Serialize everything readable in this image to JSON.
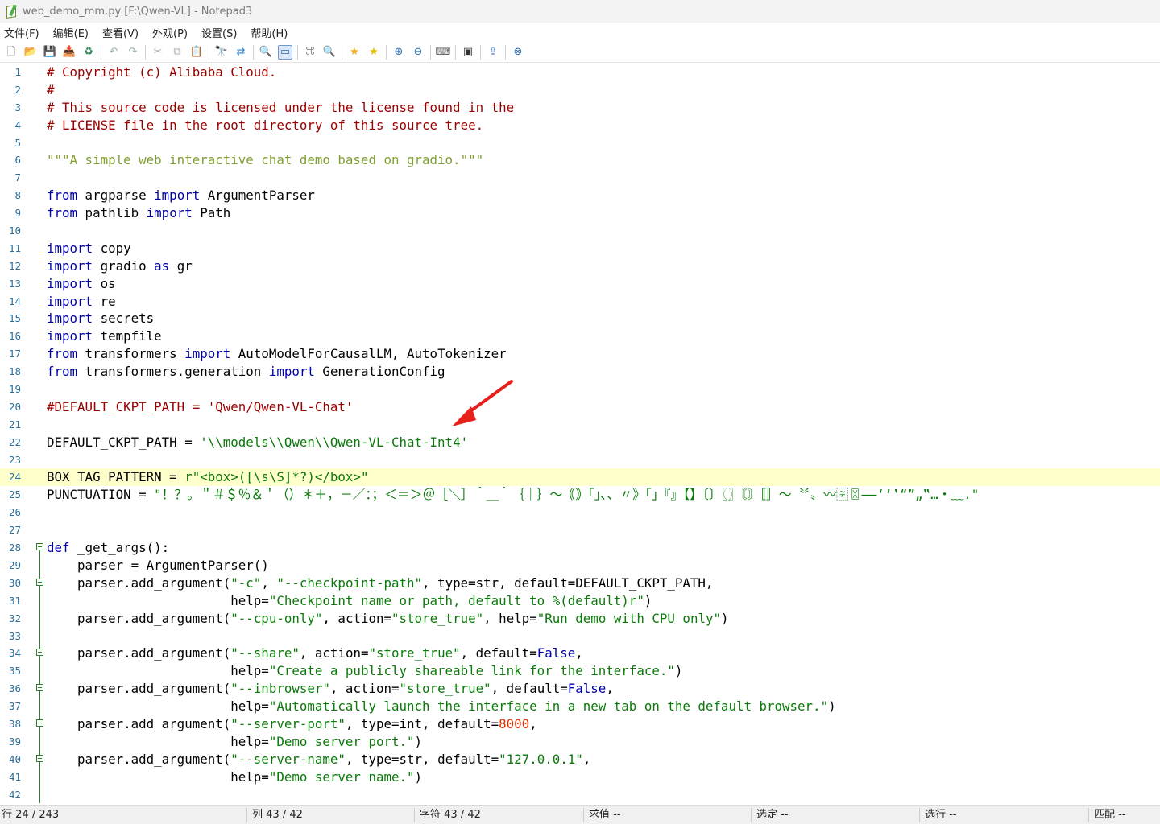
{
  "window": {
    "title": "web_demo_mm.py [F:\\Qwen-VL] - Notepad3"
  },
  "menu": [
    "文件(F)",
    "编辑(E)",
    "查看(V)",
    "外观(P)",
    "设置(S)",
    "帮助(H)"
  ],
  "toolbar": [
    {
      "name": "new-file-icon",
      "glyph": "🗋",
      "color": "#666"
    },
    {
      "name": "open-folder-icon",
      "glyph": "📂",
      "color": "#d4a017"
    },
    {
      "name": "save-icon",
      "glyph": "💾",
      "color": "#777"
    },
    {
      "name": "save-as-icon",
      "glyph": "📥",
      "color": "#c58b00"
    },
    {
      "name": "reload-icon",
      "glyph": "♻",
      "color": "#2e8b57"
    },
    {
      "sep": true
    },
    {
      "name": "undo-icon",
      "glyph": "↶",
      "color": "#9aa"
    },
    {
      "name": "redo-icon",
      "glyph": "↷",
      "color": "#9aa"
    },
    {
      "sep": true
    },
    {
      "name": "cut-icon",
      "glyph": "✂",
      "color": "#aaa"
    },
    {
      "name": "copy-icon",
      "glyph": "⧉",
      "color": "#aaa"
    },
    {
      "name": "paste-icon",
      "glyph": "📋",
      "color": "#777"
    },
    {
      "sep": true
    },
    {
      "name": "find-icon",
      "glyph": "🔭",
      "color": "#444"
    },
    {
      "name": "replace-icon",
      "glyph": "⇄",
      "color": "#2a7fd4"
    },
    {
      "sep": true
    },
    {
      "name": "find-in-files-icon",
      "glyph": "🔍",
      "color": "#555"
    },
    {
      "name": "word-wrap-icon",
      "glyph": "▭",
      "color": "#2a6fb0",
      "active": true
    },
    {
      "sep": true
    },
    {
      "name": "tree-icon",
      "glyph": "⌘",
      "color": "#888"
    },
    {
      "name": "search-icon",
      "glyph": "🔍",
      "color": "#2a6fb0"
    },
    {
      "sep": true
    },
    {
      "name": "favorite-icon",
      "glyph": "★",
      "color": "#f2b01e"
    },
    {
      "name": "add-favorite-icon",
      "glyph": "★",
      "color": "#e0c000"
    },
    {
      "sep": true
    },
    {
      "name": "zoom-in-icon",
      "glyph": "⊕",
      "color": "#2a6fb0"
    },
    {
      "name": "zoom-out-icon",
      "glyph": "⊖",
      "color": "#2a6fb0"
    },
    {
      "sep": true
    },
    {
      "name": "keyboard-icon",
      "glyph": "⌨",
      "color": "#555"
    },
    {
      "sep": true
    },
    {
      "name": "terminal-icon",
      "glyph": "▣",
      "color": "#333"
    },
    {
      "sep": true
    },
    {
      "name": "share-icon",
      "glyph": "⇪",
      "color": "#3a7bd5"
    },
    {
      "sep": true
    },
    {
      "name": "close-icon",
      "glyph": "⊗",
      "color": "#2a6fb0"
    }
  ],
  "colors": {
    "comment": "#9a0000",
    "docstring": "#7fa030",
    "keyword": "#0000a8",
    "string": "#0a7a0a",
    "number": "#e03000",
    "line_number": "#2b6f9a",
    "current_line": "#ffffcc",
    "arrow": "#e8201c"
  },
  "current_line": 24,
  "lines": [
    {
      "n": "1",
      "tokens": [
        [
          "comment",
          "# Copyright (c) Alibaba Cloud."
        ]
      ]
    },
    {
      "n": "2",
      "tokens": [
        [
          "comment",
          "#"
        ]
      ]
    },
    {
      "n": "3",
      "tokens": [
        [
          "comment",
          "# This source code is licensed under the license found in the"
        ]
      ]
    },
    {
      "n": "4",
      "tokens": [
        [
          "comment",
          "# LICENSE file in the root directory of this source tree."
        ]
      ]
    },
    {
      "n": "5",
      "tokens": []
    },
    {
      "n": "6",
      "tokens": [
        [
          "docstring",
          "\"\"\"A simple web interactive chat demo based on gradio.\"\"\""
        ]
      ]
    },
    {
      "n": "7",
      "tokens": []
    },
    {
      "n": "8",
      "tokens": [
        [
          "keyword",
          "from"
        ],
        [
          "text",
          " argparse "
        ],
        [
          "keyword",
          "import"
        ],
        [
          "text",
          " ArgumentParser"
        ]
      ]
    },
    {
      "n": "9",
      "tokens": [
        [
          "keyword",
          "from"
        ],
        [
          "text",
          " pathlib "
        ],
        [
          "keyword",
          "import"
        ],
        [
          "text",
          " Path"
        ]
      ]
    },
    {
      "n": "10",
      "tokens": []
    },
    {
      "n": "11",
      "tokens": [
        [
          "keyword",
          "import"
        ],
        [
          "text",
          " copy"
        ]
      ]
    },
    {
      "n": "12",
      "tokens": [
        [
          "keyword",
          "import"
        ],
        [
          "text",
          " gradio "
        ],
        [
          "keyword",
          "as"
        ],
        [
          "text",
          " gr"
        ]
      ]
    },
    {
      "n": "13",
      "tokens": [
        [
          "keyword",
          "import"
        ],
        [
          "text",
          " os"
        ]
      ]
    },
    {
      "n": "14",
      "tokens": [
        [
          "keyword",
          "import"
        ],
        [
          "text",
          " re"
        ]
      ]
    },
    {
      "n": "15",
      "tokens": [
        [
          "keyword",
          "import"
        ],
        [
          "text",
          " secrets"
        ]
      ]
    },
    {
      "n": "16",
      "tokens": [
        [
          "keyword",
          "import"
        ],
        [
          "text",
          " tempfile"
        ]
      ]
    },
    {
      "n": "17",
      "tokens": [
        [
          "keyword",
          "from"
        ],
        [
          "text",
          " transformers "
        ],
        [
          "keyword",
          "import"
        ],
        [
          "text",
          " AutoModelForCausalLM, AutoTokenizer"
        ]
      ]
    },
    {
      "n": "18",
      "tokens": [
        [
          "keyword",
          "from"
        ],
        [
          "text",
          " transformers.generation "
        ],
        [
          "keyword",
          "import"
        ],
        [
          "text",
          " GenerationConfig"
        ]
      ]
    },
    {
      "n": "19",
      "tokens": []
    },
    {
      "n": "20",
      "tokens": [
        [
          "comment",
          "#DEFAULT_CKPT_PATH = 'Qwen/Qwen-VL-Chat'"
        ]
      ]
    },
    {
      "n": "21",
      "tokens": []
    },
    {
      "n": "22",
      "tokens": [
        [
          "text",
          "DEFAULT_CKPT_PATH = "
        ],
        [
          "string",
          "'\\\\models\\\\Qwen\\\\Qwen-VL-Chat-Int4'"
        ]
      ]
    },
    {
      "n": "23",
      "tokens": []
    },
    {
      "n": "24",
      "tokens": [
        [
          "text",
          "BOX_TAG_PATTERN = "
        ],
        [
          "string",
          "r\"<box>([\\s\\S]*?)</box>\""
        ]
      ]
    },
    {
      "n": "25",
      "tokens": [
        [
          "text",
          "PUNCTUATION = "
        ],
        [
          "string",
          "\"！？。＂＃＄％＆＇（）＊＋，－／：；＜＝＞＠［＼］＾＿｀｛｜｝～｟｠｢｣､、〃》「」『』【】〔〕〖〗〘〙〚〛〜〝〞〟〰〾〿–—‘’‛“”„‟…‧﹏.\""
        ]
      ]
    },
    {
      "n": "26",
      "tokens": []
    },
    {
      "n": "27",
      "tokens": []
    },
    {
      "n": "28",
      "fold": "start",
      "tokens": [
        [
          "keyword",
          "def"
        ],
        [
          "text",
          " _get_args():"
        ]
      ]
    },
    {
      "n": "29",
      "fold": "line",
      "tokens": [
        [
          "text",
          "    parser = ArgumentParser()"
        ]
      ]
    },
    {
      "n": "30",
      "fold": "start",
      "tokens": [
        [
          "text",
          "    parser.add_argument("
        ],
        [
          "string",
          "\"-c\""
        ],
        [
          "text",
          ", "
        ],
        [
          "string",
          "\"--checkpoint-path\""
        ],
        [
          "text",
          ", type=str, default=DEFAULT_CKPT_PATH,"
        ]
      ]
    },
    {
      "n": "31",
      "fold": "end",
      "tokens": [
        [
          "text",
          "                        help="
        ],
        [
          "string",
          "\"Checkpoint name or path, default to %(default)r\""
        ],
        [
          "text",
          ")"
        ]
      ]
    },
    {
      "n": "32",
      "fold": "line",
      "tokens": [
        [
          "text",
          "    parser.add_argument("
        ],
        [
          "string",
          "\"--cpu-only\""
        ],
        [
          "text",
          ", action="
        ],
        [
          "string",
          "\"store_true\""
        ],
        [
          "text",
          ", help="
        ],
        [
          "string",
          "\"Run demo with CPU only\""
        ],
        [
          "text",
          ")"
        ]
      ]
    },
    {
      "n": "33",
      "fold": "line",
      "tokens": []
    },
    {
      "n": "34",
      "fold": "start",
      "tokens": [
        [
          "text",
          "    parser.add_argument("
        ],
        [
          "string",
          "\"--share\""
        ],
        [
          "text",
          ", action="
        ],
        [
          "string",
          "\"store_true\""
        ],
        [
          "text",
          ", default="
        ],
        [
          "keyword",
          "False"
        ],
        [
          "text",
          ","
        ]
      ]
    },
    {
      "n": "35",
      "fold": "end",
      "tokens": [
        [
          "text",
          "                        help="
        ],
        [
          "string",
          "\"Create a publicly shareable link for the interface.\""
        ],
        [
          "text",
          ")"
        ]
      ]
    },
    {
      "n": "36",
      "fold": "start",
      "tokens": [
        [
          "text",
          "    parser.add_argument("
        ],
        [
          "string",
          "\"--inbrowser\""
        ],
        [
          "text",
          ", action="
        ],
        [
          "string",
          "\"store_true\""
        ],
        [
          "text",
          ", default="
        ],
        [
          "keyword",
          "False"
        ],
        [
          "text",
          ","
        ]
      ]
    },
    {
      "n": "37",
      "fold": "end",
      "tokens": [
        [
          "text",
          "                        help="
        ],
        [
          "string",
          "\"Automatically launch the interface in a new tab on the default browser.\""
        ],
        [
          "text",
          ")"
        ]
      ]
    },
    {
      "n": "38",
      "fold": "start",
      "tokens": [
        [
          "text",
          "    parser.add_argument("
        ],
        [
          "string",
          "\"--server-port\""
        ],
        [
          "text",
          ", type=int, default="
        ],
        [
          "number",
          "8000"
        ],
        [
          "text",
          ","
        ]
      ]
    },
    {
      "n": "39",
      "fold": "end",
      "tokens": [
        [
          "text",
          "                        help="
        ],
        [
          "string",
          "\"Demo server port.\""
        ],
        [
          "text",
          ")"
        ]
      ]
    },
    {
      "n": "40",
      "fold": "start",
      "tokens": [
        [
          "text",
          "    parser.add_argument("
        ],
        [
          "string",
          "\"--server-name\""
        ],
        [
          "text",
          ", type=str, default="
        ],
        [
          "string",
          "\"127.0.0.1\""
        ],
        [
          "text",
          ","
        ]
      ]
    },
    {
      "n": "41",
      "fold": "end",
      "tokens": [
        [
          "text",
          "                        help="
        ],
        [
          "string",
          "\"Demo server name.\""
        ],
        [
          "text",
          ")"
        ]
      ]
    },
    {
      "n": "42",
      "fold": "line",
      "tokens": []
    }
  ],
  "statusbar": {
    "line": "行  24 / 243",
    "column": "列  43 / 42",
    "char": "字符  43 / 42",
    "eval": "求值  --",
    "selection": "选定  --",
    "selected_lines": "选行  --",
    "match": "匹配  --"
  }
}
